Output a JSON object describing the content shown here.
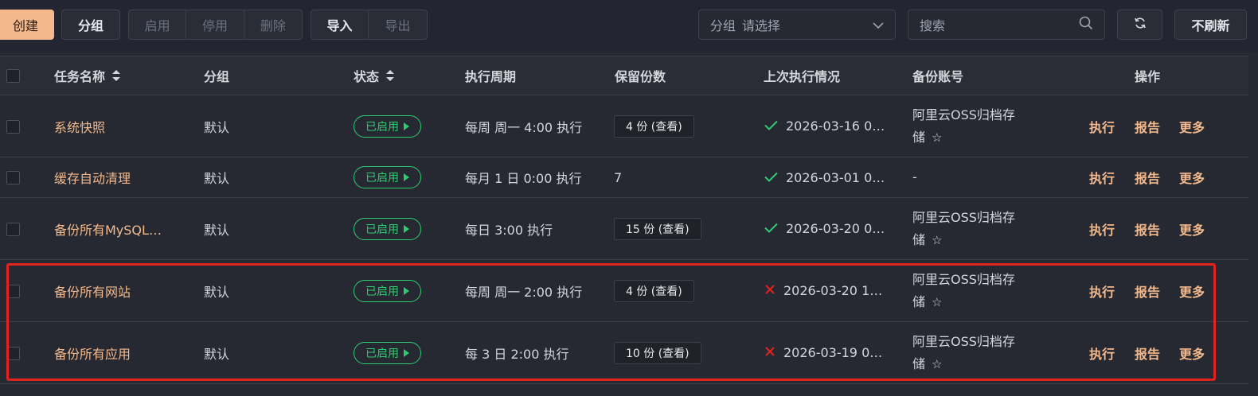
{
  "toolbar": {
    "create": "创建",
    "group": "分组",
    "enable": "启用",
    "disable": "停用",
    "delete": "删除",
    "import": "导入",
    "export": "导出",
    "group_select_label": "分组",
    "group_select_value": "请选择",
    "search_placeholder": "搜索",
    "no_refresh": "不刷新"
  },
  "columns": {
    "name": "任务名称",
    "group": "分组",
    "status": "状态",
    "schedule": "执行周期",
    "keep": "保留份数",
    "last": "上次执行情况",
    "account": "备份账号",
    "ops": "操作"
  },
  "ops": {
    "run": "执行",
    "report": "报告",
    "more": "更多"
  },
  "rows": [
    {
      "name": "系统快照",
      "group": "默认",
      "status": "已启用",
      "schedule": "每周 周一 4:00 执行",
      "keep": "4 份 (查看)",
      "keep_is_button": true,
      "last_ok": true,
      "last": "2026-03-16 0…",
      "account_line1": "阿里云OSS归档存",
      "account_line2": "储",
      "account_star": true
    },
    {
      "name": "缓存自动清理",
      "group": "默认",
      "status": "已启用",
      "schedule": "每月 1 日 0:00 执行",
      "keep": "7",
      "keep_is_button": false,
      "last_ok": true,
      "last": "2026-03-01 0…",
      "account_line1": "-",
      "account_line2": "",
      "account_star": false
    },
    {
      "name": "备份所有MySQL…",
      "group": "默认",
      "status": "已启用",
      "schedule": "每日 3:00 执行",
      "keep": "15 份 (查看)",
      "keep_is_button": true,
      "last_ok": true,
      "last": "2026-03-20 0…",
      "account_line1": "阿里云OSS归档存",
      "account_line2": "储",
      "account_star": true
    },
    {
      "name": "备份所有网站",
      "group": "默认",
      "status": "已启用",
      "schedule": "每周 周一 2:00 执行",
      "keep": "4 份 (查看)",
      "keep_is_button": true,
      "last_ok": false,
      "last": "2026-03-20 1…",
      "account_line1": "阿里云OSS归档存",
      "account_line2": "储",
      "account_star": true
    },
    {
      "name": "备份所有应用",
      "group": "默认",
      "status": "已启用",
      "schedule": "每 3 日 2:00 执行",
      "keep": "10 份 (查看)",
      "keep_is_button": true,
      "last_ok": false,
      "last": "2026-03-19 0…",
      "account_line1": "阿里云OSS归档存",
      "account_line2": "储",
      "account_star": true
    }
  ],
  "colors": {
    "accent": "#f3b98c",
    "success": "#2ecc71",
    "error": "#e0231e"
  }
}
